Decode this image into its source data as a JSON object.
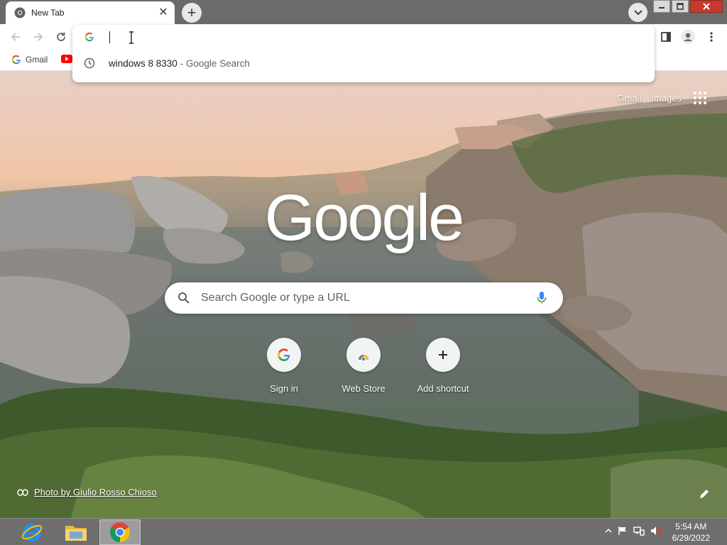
{
  "browser": {
    "tab": {
      "title": "New Tab",
      "favicon": "chrome-icon"
    },
    "new_tab_symbol": "+",
    "window_controls": [
      "minimize-icon",
      "restore-icon",
      "close-icon"
    ]
  },
  "omnibox": {
    "value": "",
    "placeholder": "",
    "suggestions": [
      {
        "text": "windows 8 8330",
        "separator": " - ",
        "description": "Google Search",
        "icon": "history-clock-icon"
      }
    ]
  },
  "bookmarks": [
    {
      "label": "Gmail",
      "icon": "google-g-icon"
    },
    {
      "label": "",
      "icon": "youtube-icon"
    }
  ],
  "ntp": {
    "top_links": [
      "Gmail",
      "Images"
    ],
    "logo": "Google",
    "search_placeholder": "Search Google or type a URL",
    "shortcuts": [
      {
        "label": "Sign in",
        "icon": "google-g-icon"
      },
      {
        "label": "Web Store",
        "icon": "web-store-icon"
      },
      {
        "label": "Add shortcut",
        "icon": "plus-icon"
      }
    ],
    "photo_credit": "Photo by Giulio Rosso Chioso"
  },
  "taskbar": {
    "apps": [
      "internet-explorer-icon",
      "file-explorer-icon",
      "chrome-icon"
    ],
    "time": "5:54 AM",
    "date": "6/29/2022"
  },
  "colors": {
    "google_blue": "#4285f4",
    "google_red": "#ea4335",
    "google_yellow": "#fbbc05",
    "google_green": "#34a853",
    "taskbar": "#6e6e6e",
    "close_red": "#c7392a"
  }
}
